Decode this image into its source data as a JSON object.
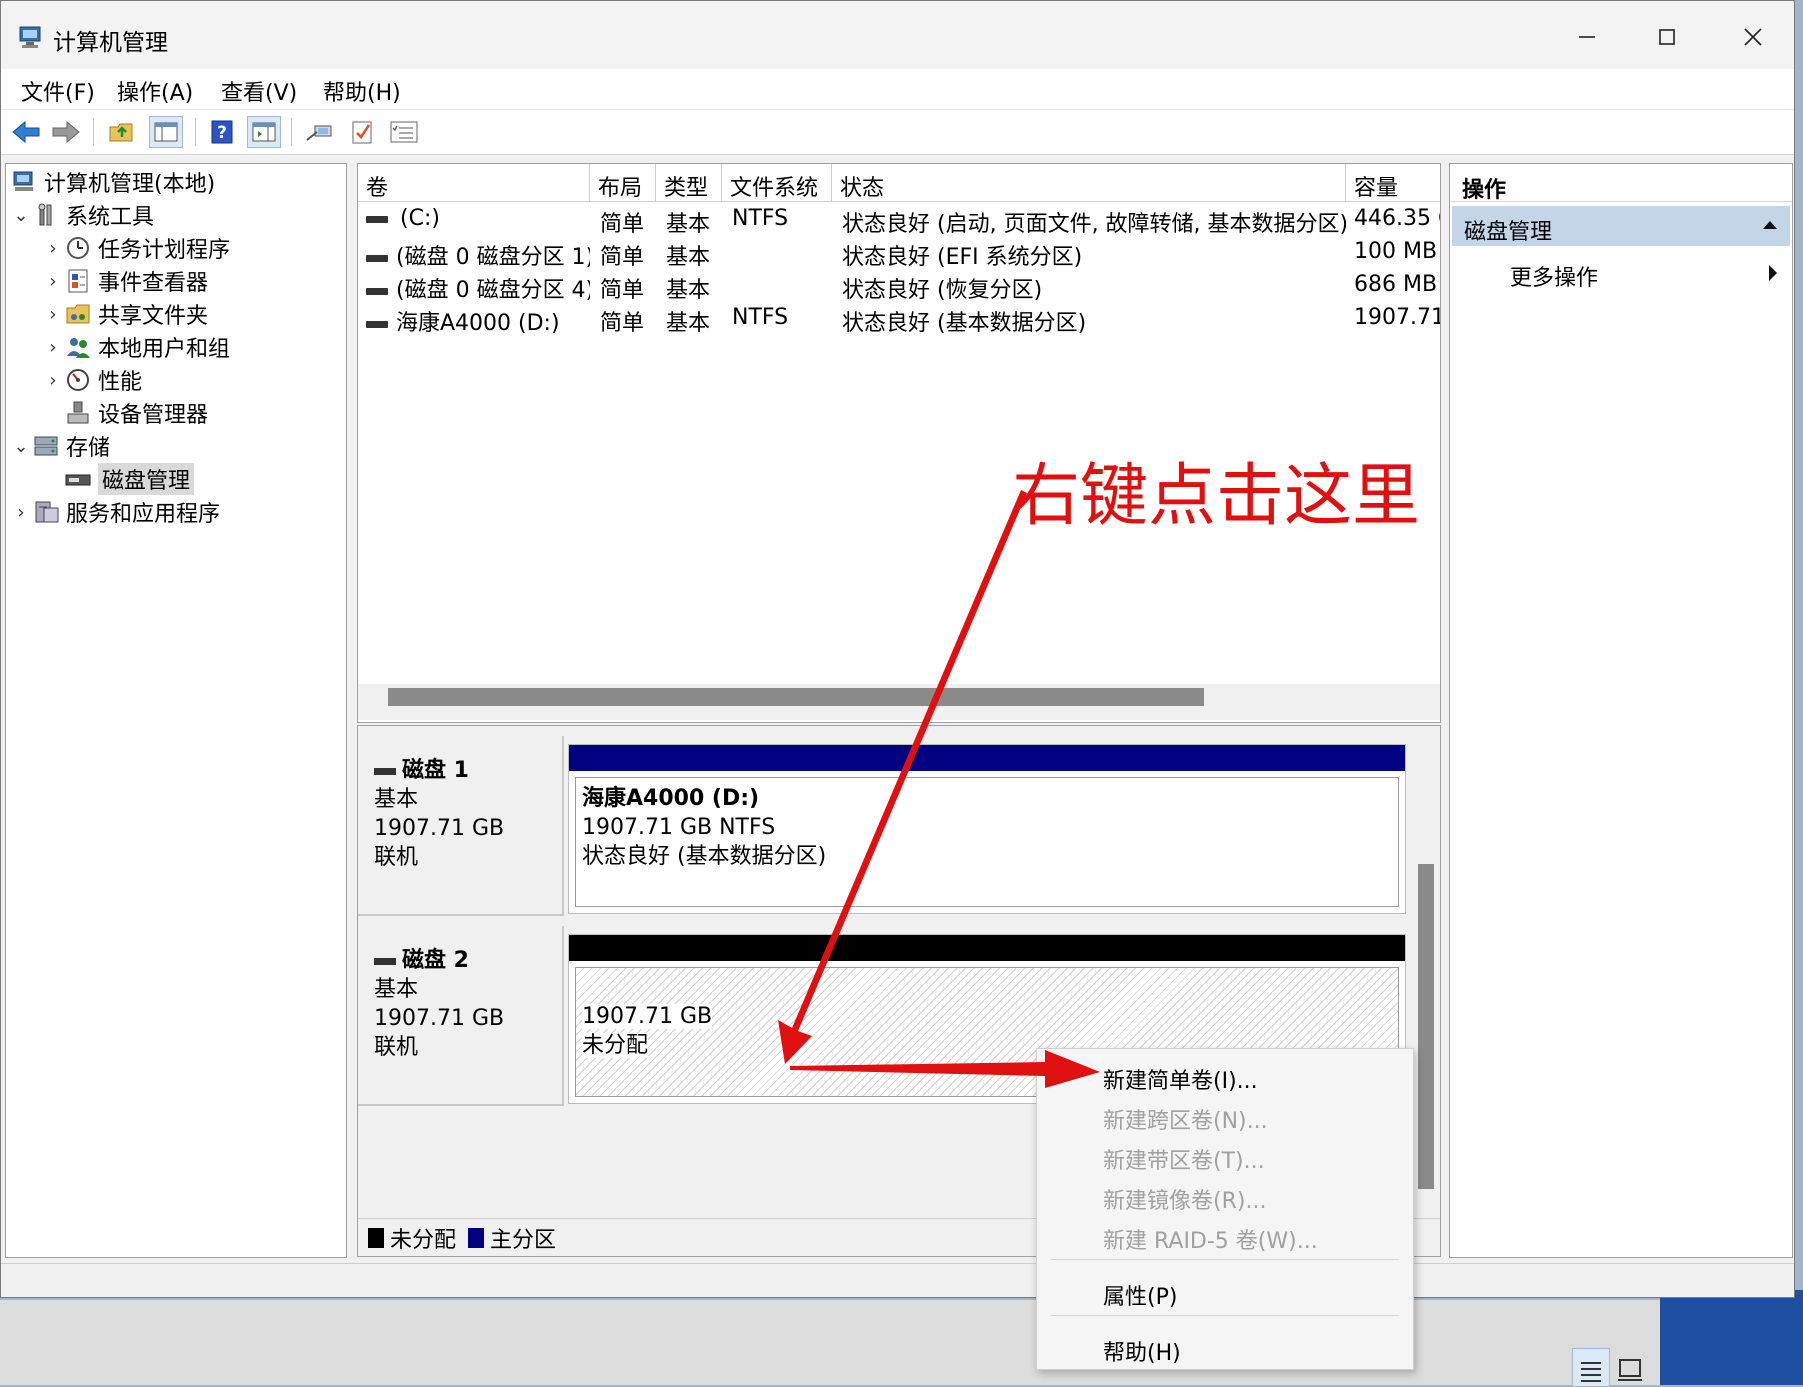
{
  "window": {
    "title": "计算机管理"
  },
  "menu": [
    "文件(F)",
    "操作(A)",
    "查看(V)",
    "帮助(H)"
  ],
  "toolbar": [
    "back-icon",
    "forward-icon",
    "up-folder-icon",
    "show-tree-icon",
    "help-icon",
    "properties-icon",
    "connect-icon",
    "checklist-icon",
    "list-icon"
  ],
  "tree": {
    "root": "计算机管理(本地)",
    "system_tools": "系统工具",
    "task_scheduler": "任务计划程序",
    "event_viewer": "事件查看器",
    "shared_folders": "共享文件夹",
    "local_users": "本地用户和组",
    "performance": "性能",
    "device_manager": "设备管理器",
    "storage": "存储",
    "disk_management": "磁盘管理",
    "services": "服务和应用程序"
  },
  "volumes": {
    "headers": [
      "卷",
      "布局",
      "类型",
      "文件系统",
      "状态",
      "容量"
    ],
    "rows": [
      {
        "name": "(C:)",
        "layout": "简单",
        "type": "基本",
        "fs": "NTFS",
        "status": "状态良好 (启动, 页面文件, 故障转储, 基本数据分区)",
        "capacity": "446.35 G"
      },
      {
        "name": "(磁盘 0 磁盘分区 1)",
        "layout": "简单",
        "type": "基本",
        "fs": "",
        "status": "状态良好 (EFI 系统分区)",
        "capacity": "100 MB"
      },
      {
        "name": "(磁盘 0 磁盘分区 4)",
        "layout": "简单",
        "type": "基本",
        "fs": "",
        "status": "状态良好 (恢复分区)",
        "capacity": "686 MB"
      },
      {
        "name": "海康A4000 (D:)",
        "layout": "简单",
        "type": "基本",
        "fs": "NTFS",
        "status": "状态良好 (基本数据分区)",
        "capacity": "1907.71"
      }
    ]
  },
  "disks": [
    {
      "name": "磁盘 1",
      "kind": "基本",
      "size": "1907.71 GB",
      "state": "联机",
      "partition": {
        "title": "海康A4000  (D:)",
        "detail": "1907.71 GB NTFS",
        "status": "状态良好 (基本数据分区)",
        "bar_color": "#000080"
      }
    },
    {
      "name": "磁盘 2",
      "kind": "基本",
      "size": "1907.71 GB",
      "state": "联机",
      "partition": {
        "size": "1907.71 GB",
        "status": "未分配",
        "bar_color": "#000000"
      }
    }
  ],
  "legend": [
    {
      "label": "未分配",
      "color": "#000000"
    },
    {
      "label": "主分区",
      "color": "#000080"
    }
  ],
  "actions": {
    "header": "操作",
    "section": "磁盘管理",
    "more": "更多操作"
  },
  "context_menu": {
    "new_simple": "新建简单卷(I)...",
    "new_spanned": "新建跨区卷(N)...",
    "new_striped": "新建带区卷(T)...",
    "new_mirrored": "新建镜像卷(R)...",
    "new_raid5": "新建 RAID-5 卷(W)...",
    "properties": "属性(P)",
    "help": "帮助(H)"
  },
  "annotation": {
    "text": "右键点击这里",
    "color": "#e01010"
  }
}
